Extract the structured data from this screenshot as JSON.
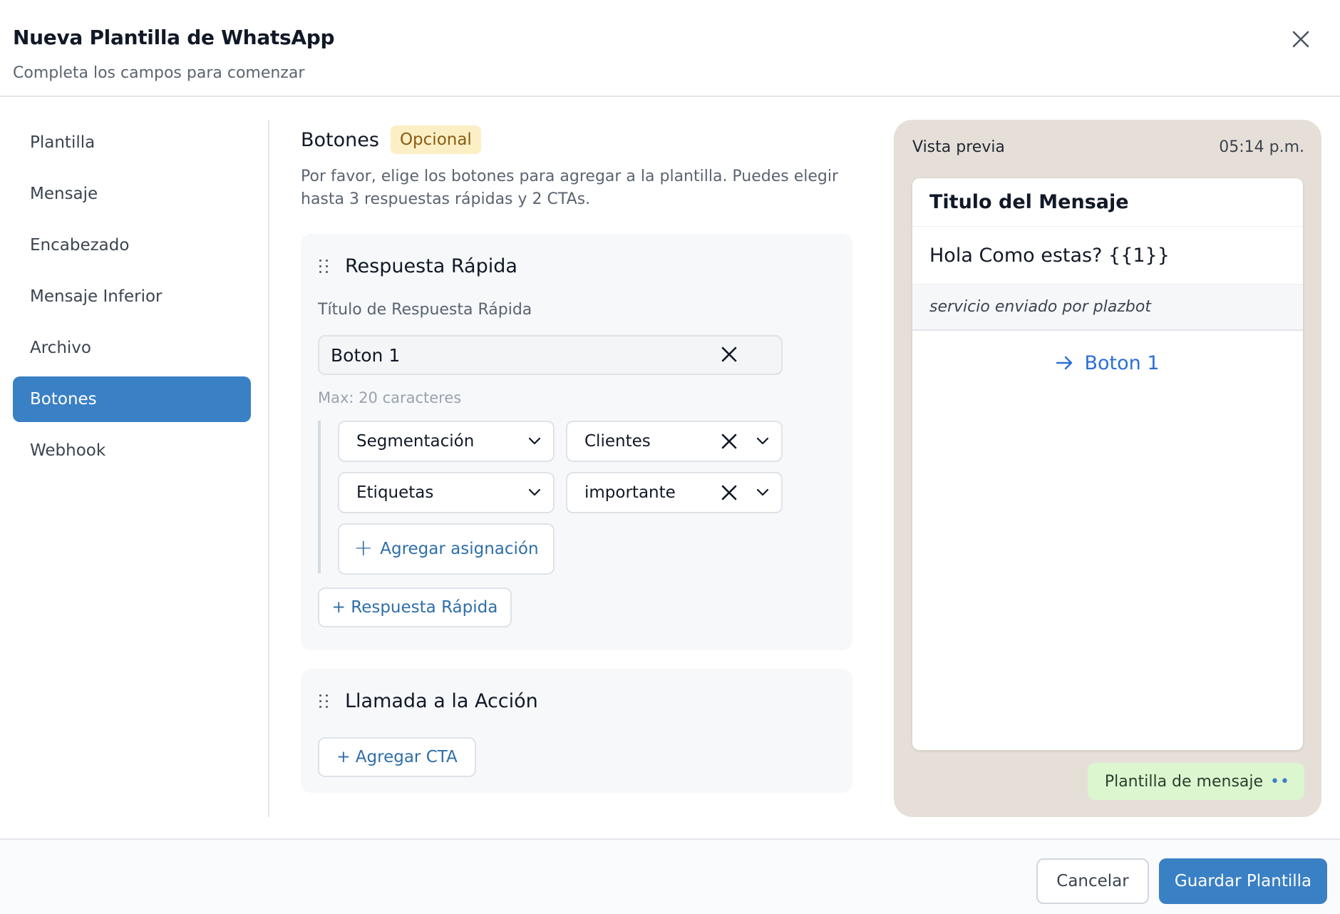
{
  "header": {
    "title": "Nueva Plantilla de WhatsApp",
    "subtitle": "Completa los campos para comenzar"
  },
  "sidebar": {
    "items": [
      {
        "label": "Plantilla",
        "active": false
      },
      {
        "label": "Mensaje",
        "active": false
      },
      {
        "label": "Encabezado",
        "active": false
      },
      {
        "label": "Mensaje Inferior",
        "active": false
      },
      {
        "label": "Archivo",
        "active": false
      },
      {
        "label": "Botones",
        "active": true
      },
      {
        "label": "Webhook",
        "active": false
      }
    ]
  },
  "main": {
    "section_title": "Botones",
    "badge": "Opcional",
    "description": "Por favor, elige los botones para agregar a la plantilla. Puedes elegir hasta 3 respuestas rápidas y 2 CTAs.",
    "quick_reply": {
      "title": "Respuesta Rápida",
      "field_label": "Título de Respuesta Rápida",
      "field_value": "Boton 1",
      "hint": "Max: 20 caracteres",
      "assignments": [
        {
          "type": "Segmentación",
          "value": "Clientes"
        },
        {
          "type": "Etiquetas",
          "value": "importante"
        }
      ],
      "add_assignment_label": "Agregar asignación",
      "add_quick_reply_label": "+ Respuesta Rápida"
    },
    "cta": {
      "title": "Llamada a la Acción",
      "add_cta_label": "+ Agregar CTA"
    }
  },
  "preview": {
    "label": "Vista previa",
    "time": "05:14 p.m.",
    "message_title": "Titulo del Mensaje",
    "message_body": "Hola Como estas?  {{1}}",
    "message_footer": "servicio enviado por plazbot",
    "button_label": "Boton 1",
    "tag": "Plantilla de mensaje"
  },
  "footer": {
    "cancel_label": "Cancelar",
    "save_label": "Guardar Plantilla"
  },
  "colors": {
    "accent": "#3a80c5",
    "link": "#2f6ea8",
    "preview_bg": "#e6dfd8",
    "badge_bg": "#fcefc6",
    "tag_bg": "#dcf6cf"
  },
  "icons": [
    "close-icon",
    "drag-handle-icon",
    "chevron-down-icon",
    "plus-icon",
    "arrow-right-icon"
  ]
}
